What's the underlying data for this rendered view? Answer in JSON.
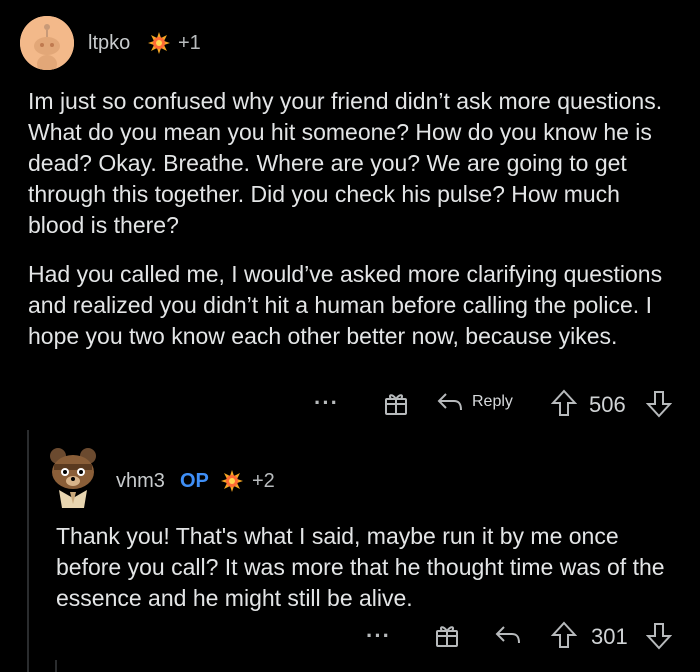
{
  "comment1": {
    "username": "ltpko",
    "award_count": "+1",
    "paragraphs": [
      "Im just so confused why your friend didn’t ask more questions. What do you mean you hit someone? How do you know he is dead? Okay. Breathe. Where are you? We are going to get through this together. Did you check his pulse? How much blood is there?",
      "Had you called me, I would’ve asked more clarifying questions and realized you didn’t hit a human before calling the police. I hope you two know each other better now, because yikes."
    ],
    "actions": {
      "more": "···",
      "reply_label": "Reply",
      "score": "506"
    }
  },
  "comment2": {
    "username": "vhm3",
    "op_badge": "OP",
    "award_count": "+2",
    "text": "Thank you! That's what I said, maybe run it by me once before you call? It was more that he thought time was of the essence and he might still be alive.",
    "actions": {
      "more": "···",
      "score": "301"
    }
  },
  "colors": {
    "background": "#000000",
    "text": "#e3e5e6",
    "op_blue": "#3f8ff7",
    "avatar_bg": "#f3b98a"
  },
  "icons": [
    "snoo-avatar-icon",
    "award-icon",
    "more-icon",
    "gift-icon",
    "reply-icon",
    "upvote-icon",
    "downvote-icon"
  ]
}
